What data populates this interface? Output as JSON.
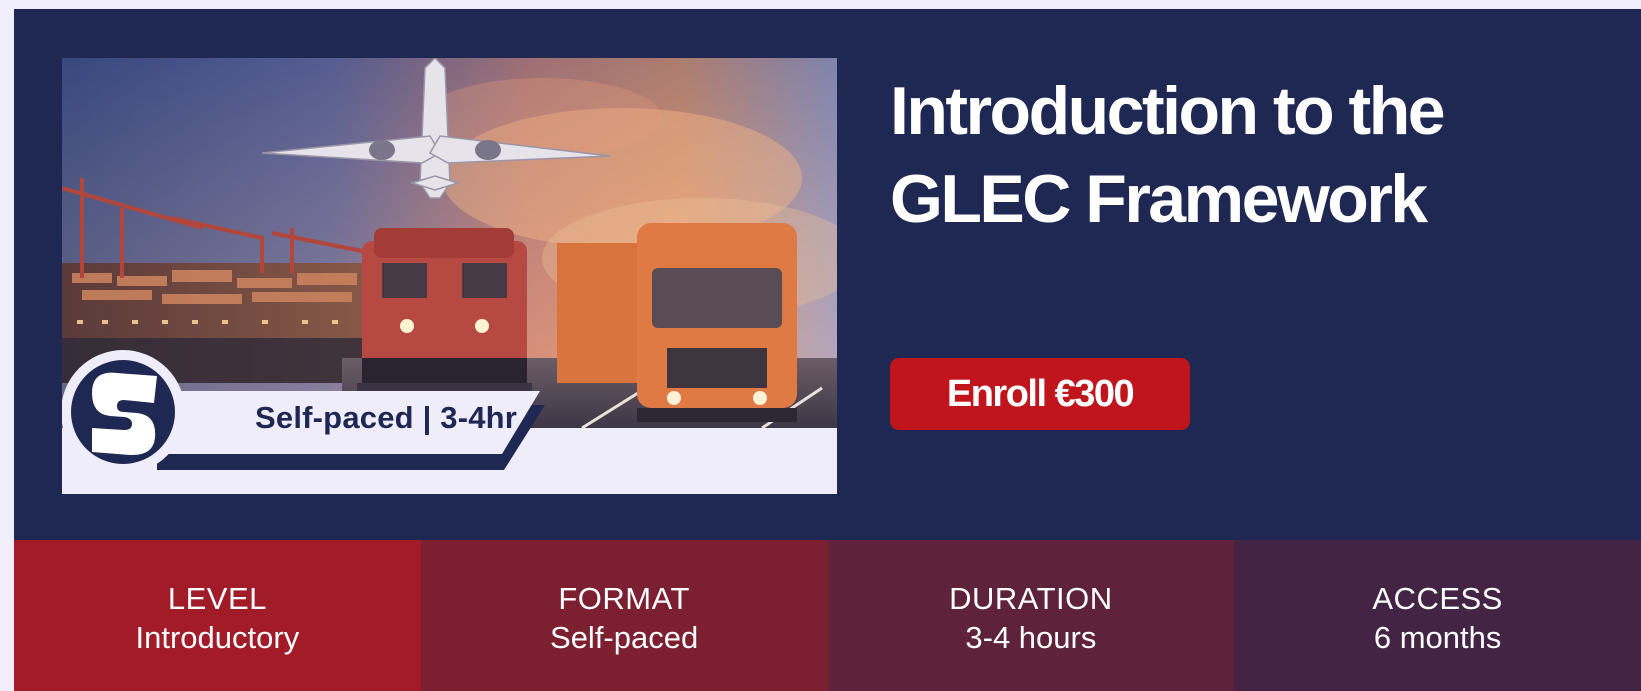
{
  "course": {
    "title": "Introduction to the GLEC Framework",
    "enroll_label": "Enroll €300",
    "thumbnail_badge": "Self-paced | 3-4hr"
  },
  "stats": [
    {
      "label": "LEVEL",
      "value": "Introductory",
      "color": "#a11b28"
    },
    {
      "label": "FORMAT",
      "value": "Self-paced",
      "color": "#7c1f30"
    },
    {
      "label": "DURATION",
      "value": "3-4 hours",
      "color": "#5e223b"
    },
    {
      "label": "ACCESS",
      "value": "6 months",
      "color": "#442444"
    }
  ],
  "colors": {
    "hero_background": "#1f2853",
    "enroll_button": "#c0151c",
    "badge_text": "#1f2853"
  },
  "icons": {
    "logo": "s-logo-icon"
  }
}
